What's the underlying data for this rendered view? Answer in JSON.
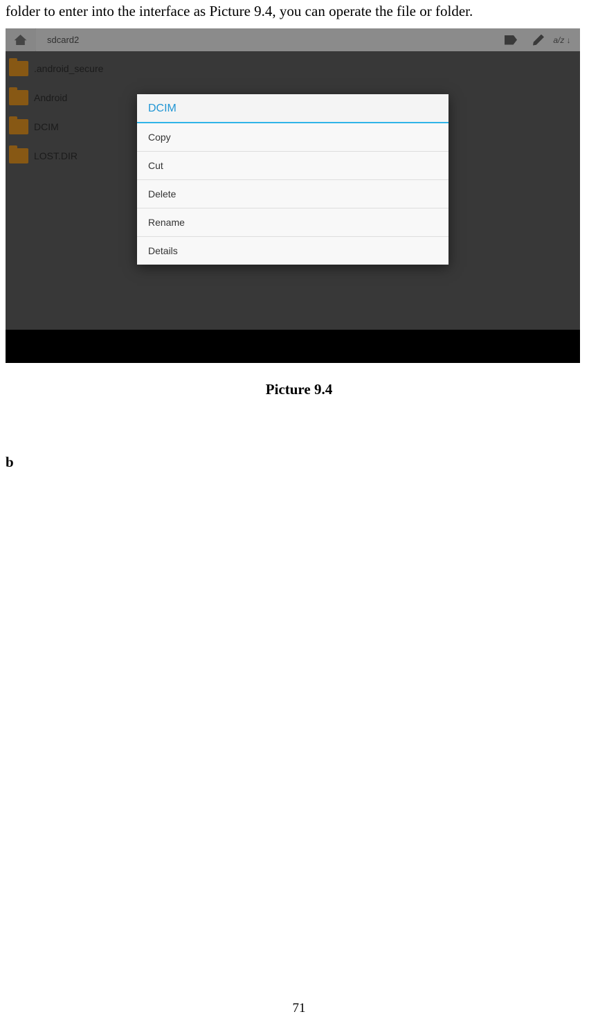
{
  "intro_text": "folder to enter into the interface as Picture 9.4, you can operate the file or folder.",
  "caption": "Picture 9.4",
  "loose_b": "b",
  "page_number": "71",
  "screenshot": {
    "breadcrumb": "sdcard2",
    "sort_label": "a/z ↓",
    "files": [
      ".android_secure",
      "Android",
      "DCIM",
      "LOST.DIR"
    ],
    "popup": {
      "title": "DCIM",
      "items": [
        "Copy",
        "Cut",
        "Delete",
        "Rename",
        "Details"
      ]
    }
  }
}
